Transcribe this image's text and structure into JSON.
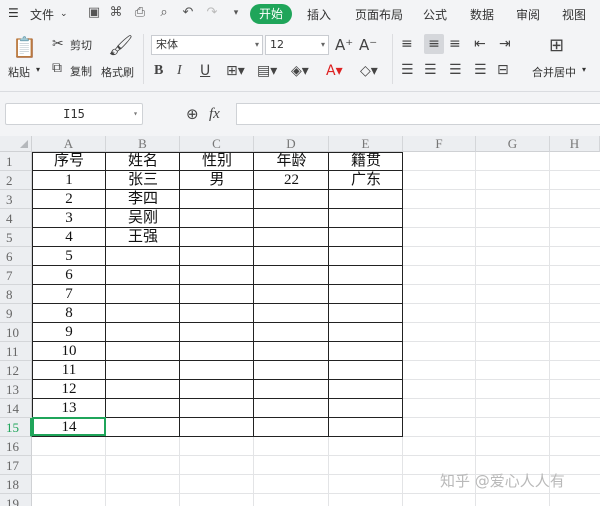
{
  "menubar": {
    "file_label": "文件",
    "tabs": [
      "开始",
      "插入",
      "页面布局",
      "公式",
      "数据",
      "审阅",
      "视图"
    ]
  },
  "ribbon": {
    "paste": "粘贴",
    "cut": "剪切",
    "copy": "复制",
    "format_painter": "格式刷",
    "font_name": "宋体",
    "font_size": "12",
    "merge_center": "合并居中"
  },
  "formula_bar": {
    "cell_ref": "I15",
    "fx": "fx",
    "formula": ""
  },
  "sheet": {
    "columns": [
      "A",
      "B",
      "C",
      "D",
      "E",
      "F",
      "G",
      "H"
    ],
    "rows": [
      "1",
      "2",
      "3",
      "4",
      "5",
      "6",
      "7",
      "8",
      "9",
      "10",
      "11",
      "12",
      "13",
      "14",
      "15",
      "16",
      "17",
      "18",
      "19"
    ],
    "header": [
      "序号",
      "姓名",
      "性别",
      "年龄",
      "籍贯"
    ],
    "data_rows": [
      [
        "1",
        "张三",
        "男",
        "22",
        "广东"
      ],
      [
        "2",
        "李四",
        "",
        "",
        ""
      ],
      [
        "3",
        "吴刚",
        "",
        "",
        ""
      ],
      [
        "4",
        "王强",
        "",
        "",
        ""
      ],
      [
        "5",
        "",
        "",
        "",
        ""
      ],
      [
        "6",
        "",
        "",
        "",
        ""
      ],
      [
        "7",
        "",
        "",
        "",
        ""
      ],
      [
        "8",
        "",
        "",
        "",
        ""
      ],
      [
        "9",
        "",
        "",
        "",
        ""
      ],
      [
        "10",
        "",
        "",
        "",
        ""
      ],
      [
        "11",
        "",
        "",
        "",
        ""
      ],
      [
        "12",
        "",
        "",
        "",
        ""
      ],
      [
        "13",
        "",
        "",
        "",
        ""
      ],
      [
        "14",
        "",
        "",
        "",
        ""
      ]
    ],
    "active_row": "15"
  },
  "watermark": "知乎 @爱心人人有",
  "colors": {
    "accent": "#1fa55a"
  }
}
